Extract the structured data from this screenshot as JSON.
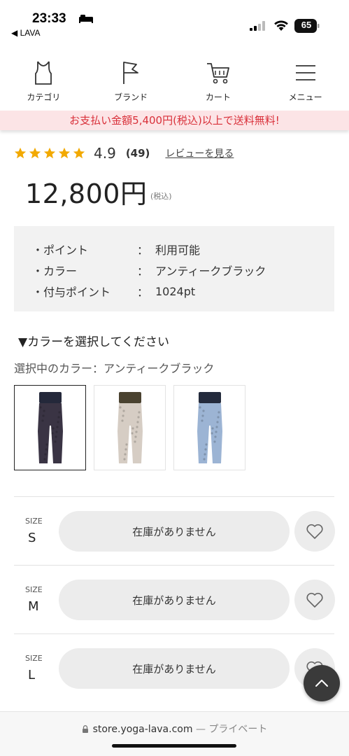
{
  "status": {
    "time": "23:33",
    "back_app": "◀ LAVA",
    "battery": "65"
  },
  "nav": {
    "items": [
      {
        "label": "カテゴリ",
        "icon": "tank-top-icon"
      },
      {
        "label": "ブランド",
        "icon": "flag-icon"
      },
      {
        "label": "カート",
        "icon": "cart-icon"
      },
      {
        "label": "メニュー",
        "icon": "hamburger-menu-icon"
      }
    ]
  },
  "promo": {
    "text": "お支払い金額5,400円(税込)以上で送料無料!"
  },
  "rating": {
    "stars": 5,
    "score": "4.9",
    "count": "(49)",
    "review_link": "レビューを見る"
  },
  "price": {
    "amount": "12,800円",
    "tax": "(税込)"
  },
  "info": {
    "rows": [
      {
        "key": "・ポイント",
        "sep": "：",
        "value": "利用可能"
      },
      {
        "key": "・カラー",
        "sep": "：",
        "value": "アンティークブラック"
      },
      {
        "key": "・付与ポイント",
        "sep": "：",
        "value": "1024pt"
      }
    ]
  },
  "color": {
    "heading": "▼カラーを選択してください",
    "current": "選択中のカラー：アンティークブラック",
    "swatches": [
      {
        "name": "antique-black",
        "pant_color": "#3a3444",
        "band_color": "#24283a",
        "selected": true
      },
      {
        "name": "antique-beige",
        "pant_color": "#d6cdc4",
        "band_color": "#4a4230",
        "selected": false
      },
      {
        "name": "antique-blue",
        "pant_color": "#9cb4d4",
        "band_color": "#232a3c",
        "selected": false
      }
    ]
  },
  "sizes": {
    "label": "SIZE",
    "rows": [
      {
        "size": "S",
        "stock": "在庫がありません"
      },
      {
        "size": "M",
        "stock": "在庫がありません"
      },
      {
        "size": "L",
        "stock": "在庫がありません"
      }
    ]
  },
  "url_bar": {
    "domain": "store.yoga-lava.com",
    "suffix": " — プライベート"
  },
  "colors": {
    "accent_red": "#d9303a",
    "promo_bg": "#fce4e6",
    "star": "#f2a900"
  }
}
